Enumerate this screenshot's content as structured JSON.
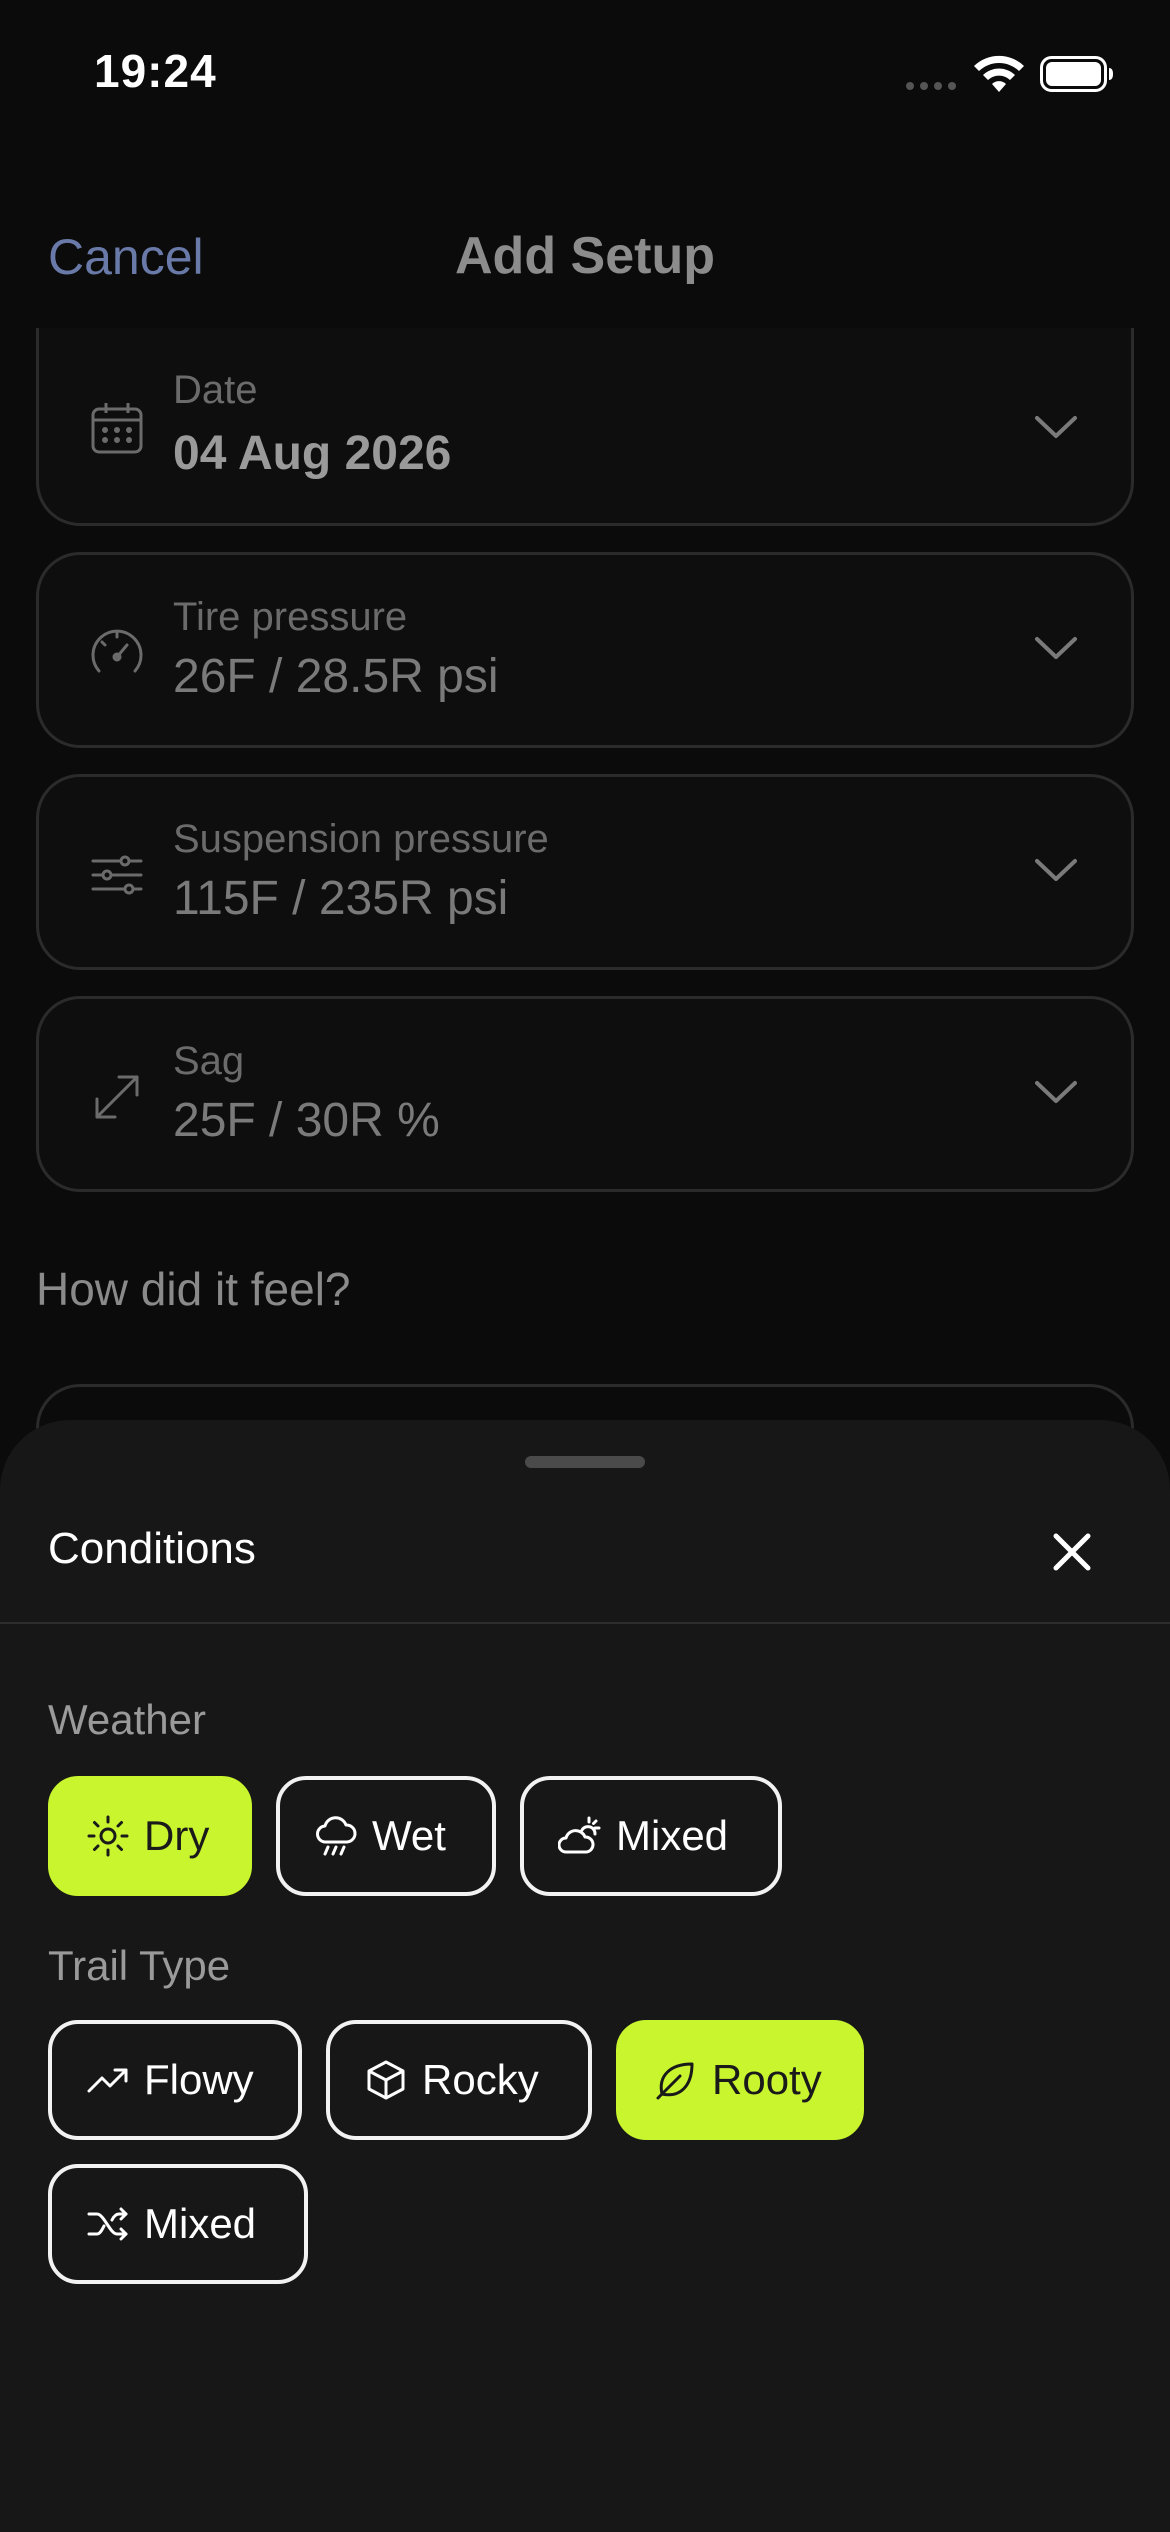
{
  "status": {
    "time": "19:24"
  },
  "nav": {
    "cancel": "Cancel",
    "title": "Add Setup"
  },
  "fields": [
    {
      "label": "Date",
      "value": "04 Aug 2026",
      "icon": "calendar-icon"
    },
    {
      "label": "Tire pressure",
      "value": "26F / 28.5R psi",
      "icon": "gauge-icon"
    },
    {
      "label": "Suspension pressure",
      "value": "115F / 235R psi",
      "icon": "sliders-icon"
    },
    {
      "label": "Sag",
      "value": "25F / 30R %",
      "icon": "expand-arrows-icon"
    }
  ],
  "feel_heading": "How did it feel?",
  "sheet": {
    "title": "Conditions",
    "weather_label": "Weather",
    "weather": [
      {
        "label": "Dry",
        "icon": "sun-icon",
        "selected": true
      },
      {
        "label": "Wet",
        "icon": "rain-cloud-icon",
        "selected": false
      },
      {
        "label": "Mixed",
        "icon": "partly-cloudy-icon",
        "selected": false
      }
    ],
    "trail_label": "Trail Type",
    "trail": [
      {
        "label": "Flowy",
        "icon": "trend-up-icon",
        "selected": false
      },
      {
        "label": "Rocky",
        "icon": "box-icon",
        "selected": false
      },
      {
        "label": "Rooty",
        "icon": "leaf-icon",
        "selected": true
      },
      {
        "label": "Mixed",
        "icon": "shuffle-icon",
        "selected": false
      }
    ]
  },
  "colors": {
    "accent": "#c8f52e",
    "sheet_bg": "#171717",
    "link": "#6a7aa8"
  }
}
